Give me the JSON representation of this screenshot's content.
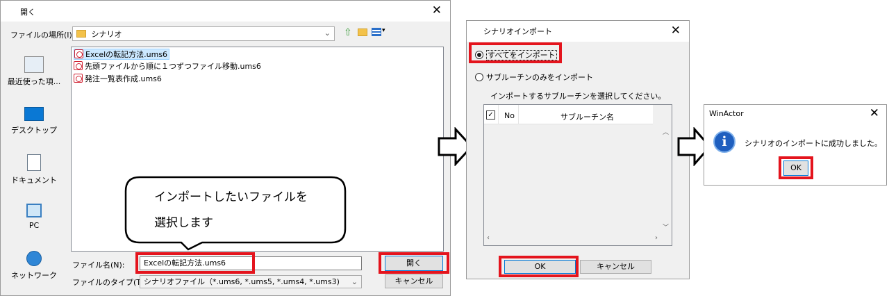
{
  "open_dialog": {
    "title": "開く",
    "location_label": "ファイルの場所(I):",
    "location_value": "シナリオ",
    "sidebar": [
      {
        "name": "recent",
        "label": "最近使った項..."
      },
      {
        "name": "desktop",
        "label": "デスクトップ"
      },
      {
        "name": "documents",
        "label": "ドキュメント"
      },
      {
        "name": "pc",
        "label": "PC"
      },
      {
        "name": "network",
        "label": "ネットワーク"
      }
    ],
    "files": [
      "Excelの転記方法.ums6",
      "先頭ファイルから順に１つずつファイル移動.ums6",
      "発注一覧表作成.ums6"
    ],
    "filename_label": "ファイル名(N):",
    "filename_value": "Excelの転記方法.ums6",
    "filetype_label": "ファイルのタイプ(T):",
    "filetype_value": "シナリオファイル（*.ums6, *.ums5, *.ums4, *.ums3)",
    "open_button": "開く",
    "cancel_button": "キャンセル"
  },
  "callout": {
    "line1": "インポートしたいファイルを",
    "line2": "選択します"
  },
  "import_dialog": {
    "title": "シナリオインポート",
    "option_all": "すべてをインポート",
    "option_sub": "サブルーチンのみをインポート",
    "instruction": "インポートするサブルーチンを選択してください。",
    "col_no": "No",
    "col_name": "サブルーチン名",
    "ok_button": "OK",
    "cancel_button": "キャンセル"
  },
  "message_dialog": {
    "title": "WinActor",
    "message": "シナリオのインポートに成功しました。",
    "ok_button": "OK"
  },
  "colors": {
    "highlight": "#e4141d",
    "selection": "#cce8ff",
    "info_icon": "#1f5fbf"
  }
}
